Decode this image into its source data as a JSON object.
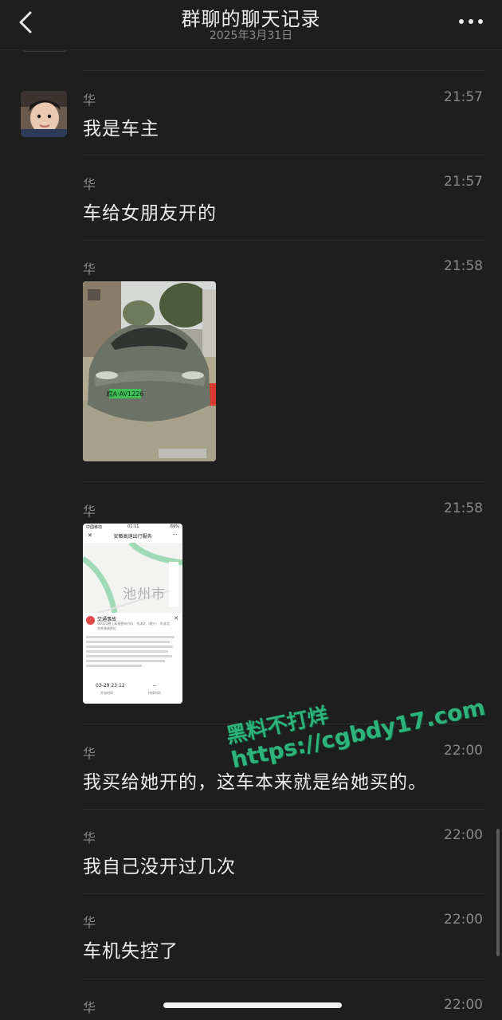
{
  "header": {
    "title": "群聊的聊天记录",
    "subtitle": "2025年3月31日",
    "back_icon": "chevron-left-icon",
    "more_icon": "more-dots-icon"
  },
  "messages": [
    {
      "sender": "华",
      "time": "21:57",
      "text": "我是车主"
    },
    {
      "sender": "华",
      "time": "21:57",
      "text": "车给女朋友开的"
    },
    {
      "sender": "华",
      "time": "21:58",
      "image": "car-photo",
      "plate": "皖A·AV1226"
    },
    {
      "sender": "华",
      "time": "21:58",
      "image": "traffic-screenshot"
    },
    {
      "sender": "华",
      "time": "22:00",
      "text": "我买给她开的，这车本来就是给她买的。"
    },
    {
      "sender": "华",
      "time": "22:00",
      "text": "我自己没开过几次"
    },
    {
      "sender": "华",
      "time": "22:00",
      "text": "车机失控了"
    },
    {
      "sender": "华",
      "time": "22:00"
    }
  ],
  "screenshot": {
    "carrier": "中国移动",
    "clock": "01:11",
    "battery": "69%",
    "nav_title": "安徽高速出行服务",
    "map_label": "池州市",
    "card_title": "交通事故",
    "card_sub": "G0321德上高速德州方向：东流北（建兴）-东流北合并路线附近",
    "start_time": "03-29 23:12",
    "start_label": "开始时间",
    "duration": "--",
    "duration_label": "持续时间"
  },
  "watermark": {
    "line1": "黑料不打烊",
    "line2": "https://cgbdy17.com"
  },
  "colors": {
    "background": "#1e1e1e",
    "text": "#ececec",
    "muted": "#8a8a8a",
    "watermark": "#2fb37c"
  }
}
